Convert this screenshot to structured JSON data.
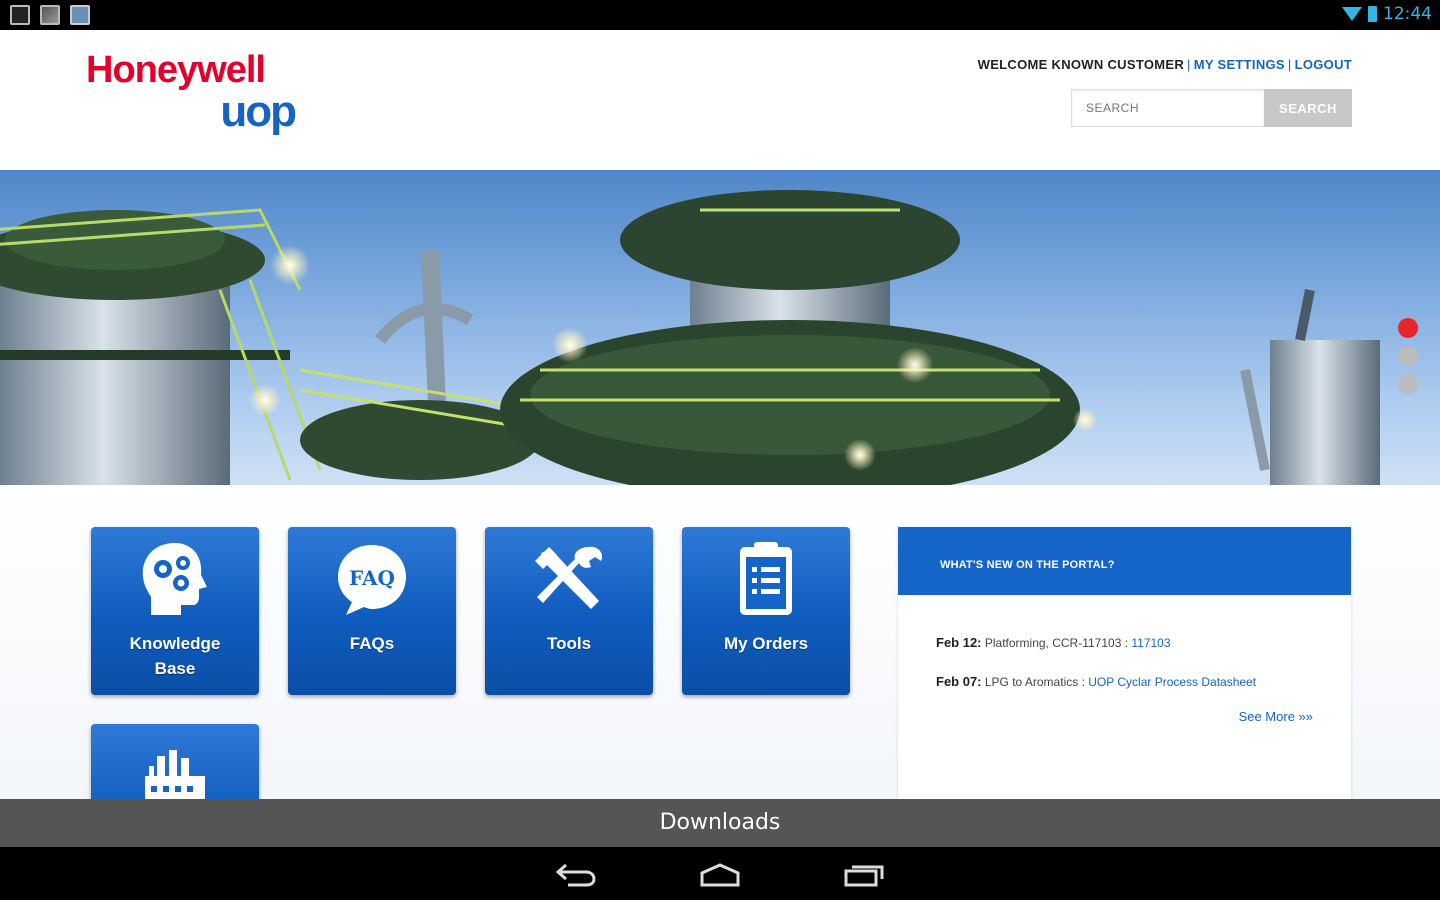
{
  "status_bar": {
    "time": "12:44",
    "notification_icons": [
      "sd-card-icon",
      "image-icon",
      "app-icon"
    ],
    "accent_color": "#33b5e5"
  },
  "header": {
    "logo": {
      "brand": "Honeywell",
      "sub": "uop"
    },
    "welcome_text": "WELCOME KNOWN CUSTOMER",
    "settings_link": "MY SETTINGS",
    "logout_link": "LOGOUT",
    "search": {
      "placeholder": "SEARCH",
      "button_label": "SEARCH"
    }
  },
  "banner": {
    "slides_count": 3,
    "active_slide": 1
  },
  "tiles": [
    {
      "label": "Knowledge Base",
      "icon": "head-gears-icon"
    },
    {
      "label": "FAQs",
      "icon": "faq-bubble-icon",
      "icon_text": "FAQ"
    },
    {
      "label": "Tools",
      "icon": "tools-icon"
    },
    {
      "label": "My Orders",
      "icon": "clipboard-icon"
    },
    {
      "label": "",
      "icon": "factory-icon"
    }
  ],
  "news": {
    "title": "WHAT'S NEW ON THE PORTAL?",
    "items": [
      {
        "date": "Feb 12:",
        "text": "Platforming, CCR-117103 : ",
        "link": "117103"
      },
      {
        "date": "Feb 07:",
        "text": "LPG to Aromatics : ",
        "link": "UOP Cyclar Process Datasheet"
      }
    ],
    "see_more": "See More »»"
  },
  "bottom_bar": {
    "label": "Downloads"
  },
  "colors": {
    "primary_blue": "#1565c9",
    "brand_red": "#e4002b",
    "dot_active": "#e8262b"
  }
}
